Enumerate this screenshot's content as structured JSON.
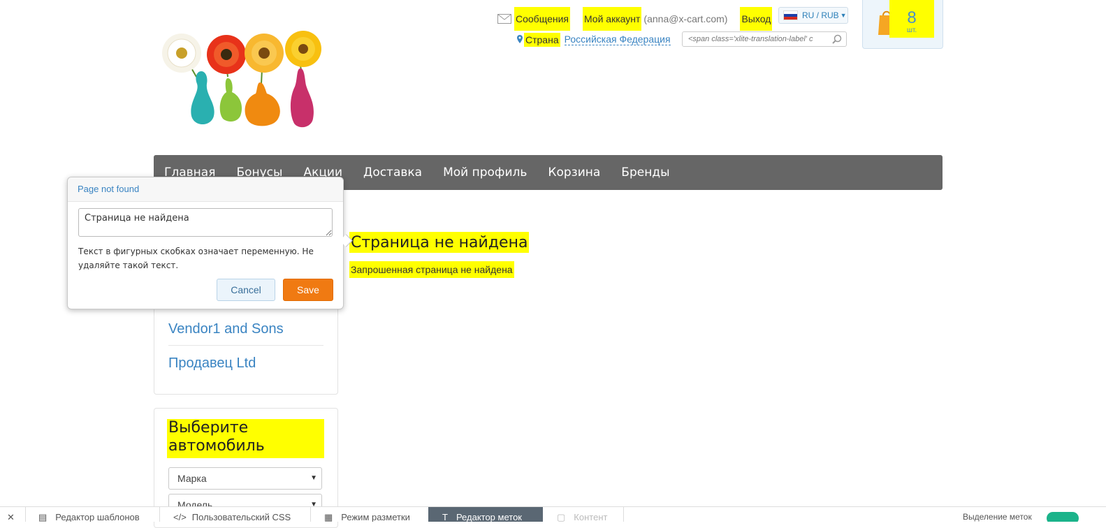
{
  "header": {
    "messages_label": "Сообщения",
    "account_label": "Мой аккаунт",
    "account_email": "(anna@x-cart.com)",
    "logout_label": "Выход",
    "lang_currency": "RU / RUB",
    "country_label": "Страна",
    "country_value": "Российская Федерация",
    "search_placeholder": "<span class='xlite-translation-label' c",
    "cart_count": "8",
    "cart_unit": "шт."
  },
  "nav": {
    "items": [
      "Главная",
      "Бонусы",
      "Акции",
      "Доставка",
      "Мой профиль",
      "Корзина",
      "Бренды"
    ]
  },
  "main": {
    "title": "Страница не найдена",
    "subtitle": "Запрошенная страница не найдена"
  },
  "sidebar": {
    "vendors": [
      "Vendor1 and Sons",
      "Продавец Ltd"
    ],
    "car_title": "Выберите автомобиль",
    "make_select": "Марка",
    "model_select": "Модель"
  },
  "editor_popup": {
    "title": "Page not found",
    "text_value": "Страница не найдена",
    "hint": "Текст в фигурных скобках означает переменную. Не удаляйте такой текст.",
    "cancel_label": "Cancel",
    "save_label": "Save"
  },
  "bottom_bar": {
    "items": [
      "Редактор шаблонов",
      "Пользовательский CSS",
      "Режим разметки",
      "Редактор меток",
      "Контент"
    ],
    "right_label": "Выделение меток"
  },
  "colors": {
    "highlight": "#ffff00",
    "nav_bg": "#666666",
    "link": "#3a84c2",
    "save_button": "#f07a12",
    "toggle": "#1bb38a"
  }
}
